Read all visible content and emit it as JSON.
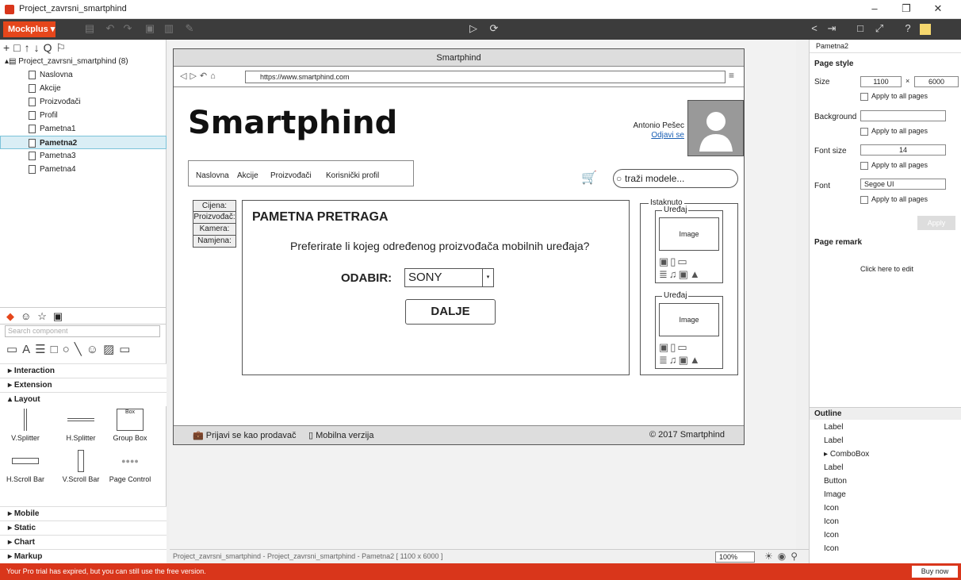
{
  "window": {
    "title": "Project_zavrsni_smartphind",
    "minimize": "–",
    "restore": "❐",
    "close": "✕"
  },
  "toolbar": {
    "brand": "Mockplus ▾"
  },
  "tree": {
    "root": "Project_zavrsni_smartphind (8)",
    "pages": [
      "Naslovna",
      "Akcije",
      "Proizvođači",
      "Profil",
      "Pametna1",
      "Pametna2",
      "Pametna3",
      "Pametna4"
    ],
    "selected": "Pametna2"
  },
  "components": {
    "search_placeholder": "Search component",
    "categories_top": [
      "Interaction",
      "Extension",
      "Layout"
    ],
    "layout_items": [
      "V.Splitter",
      "H.Splitter",
      "Group Box",
      "H.Scroll Bar",
      "V.Scroll Bar",
      "Page Control"
    ],
    "box_label": "Box",
    "categories_bottom": [
      "Mobile",
      "Static",
      "Chart",
      "Markup"
    ]
  },
  "mock": {
    "window_title": "Smartphind",
    "url": "https://www.smartphind.com",
    "logo": "Smartphind",
    "user_name": "Antonio Pešec",
    "logout": "Odjavi se",
    "nav": [
      "Naslovna",
      "Akcije",
      "Proizvođači",
      "Korisnički profil"
    ],
    "search_placeholder": "traži modele...",
    "side_tabs": [
      "Cijena:",
      "Proizvođač:",
      "Kamera:",
      "Namjena:"
    ],
    "panel_title": "PAMETNA PRETRAGA",
    "question": "Preferirate li kojeg određenog proizvođača mobilnih uređaja?",
    "choose_label": "ODABIR:",
    "choose_value": "SONY",
    "next_button": "DALJE",
    "featured": {
      "title": "Istaknuto",
      "device": "Uređaj",
      "image": "Image"
    },
    "footer": {
      "seller": "Prijavi se kao prodavač",
      "mobile": "Mobilna verzija",
      "copyright": "2017 Smartphind"
    }
  },
  "canvas_status": {
    "path": "Project_zavrsni_smartphind - Project_zavrsni_smartphind - Pametna2 [ 1100 x 6000 ]",
    "zoom": "100%"
  },
  "right": {
    "page_name": "Pametna2",
    "section": "Page style",
    "size_label": "Size",
    "width": "1100",
    "height": "6000",
    "x": "×",
    "apply_all": "Apply to all pages",
    "background_label": "Background",
    "fontsize_label": "Font size",
    "fontsize": "14",
    "font_label": "Font",
    "font": "Segoe UI",
    "apply": "Apply",
    "remark_label": "Page remark",
    "remark_hint": "Click here to edit",
    "outline_title": "Outline",
    "outline": [
      "Label",
      "Label",
      "ComboBox",
      "Label",
      "Button",
      "Image",
      "Icon",
      "Icon",
      "Icon",
      "Icon"
    ]
  },
  "status": {
    "message": "Your Pro trial has expired, but you can still use the free version.",
    "buy": "Buy now"
  }
}
